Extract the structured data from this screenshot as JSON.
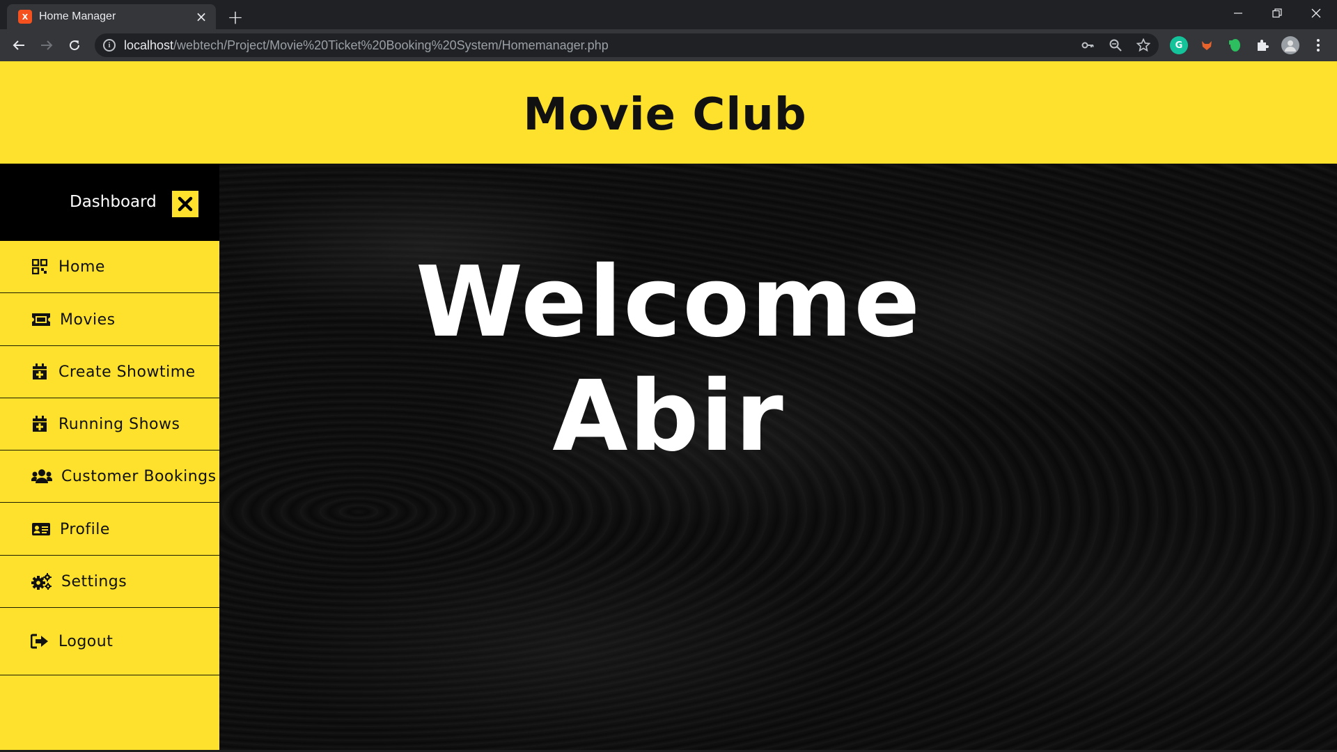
{
  "browser": {
    "tab_title": "Home Manager",
    "favicon_text": "X",
    "url_host": "localhost",
    "url_path": "/webtech/Project/Movie%20Ticket%20Booking%20System/Homemanager.php"
  },
  "header": {
    "title": "Movie Club"
  },
  "sidebar": {
    "heading": "Dashboard",
    "items": [
      {
        "label": "Home",
        "icon": "grid-icon"
      },
      {
        "label": "Movies",
        "icon": "ticket-icon"
      },
      {
        "label": "Create Showtime",
        "icon": "calendar-plus-icon"
      },
      {
        "label": "Running Shows",
        "icon": "calendar-plus-icon"
      },
      {
        "label": "Customer Bookings",
        "icon": "users-icon"
      },
      {
        "label": "Profile",
        "icon": "id-card-icon"
      },
      {
        "label": "Settings",
        "icon": "gears-icon"
      },
      {
        "label": "Logout",
        "icon": "sign-out-icon"
      }
    ]
  },
  "main": {
    "welcome_line": "Welcome",
    "user_name": "Abir"
  },
  "colors": {
    "accent": "#fee12d",
    "sidebar_head_bg": "#000000",
    "text_dark": "#111111"
  }
}
